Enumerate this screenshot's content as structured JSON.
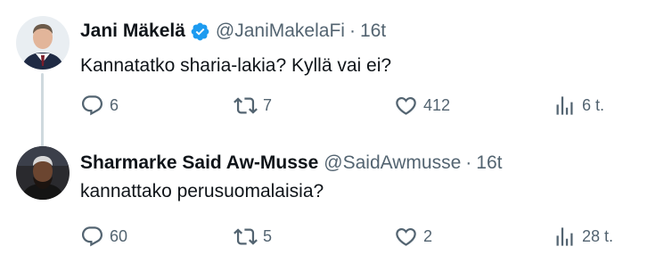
{
  "tweets": [
    {
      "name": "Jani Mäkelä",
      "verified": true,
      "handle": "@JaniMakelaFi",
      "separator": "·",
      "time": "16t",
      "text": "Kannatatko sharia-lakia? Kyllä vai ei?",
      "replies": "6",
      "retweets": "7",
      "likes": "412",
      "views": "6 t."
    },
    {
      "name": "Sharmarke Said Aw-Musse",
      "verified": false,
      "handle": "@SaidAwmusse",
      "separator": "·",
      "time": "16t",
      "text": "kannattako perusuomalaisia?",
      "replies": "60",
      "retweets": "5",
      "likes": "2",
      "views": "28 t."
    }
  ],
  "colors": {
    "text_primary": "#0f1419",
    "text_secondary": "#536471",
    "verified_blue": "#1d9bf0",
    "thread_line": "#cfd9de"
  },
  "icons": {
    "reply": "reply-icon",
    "retweet": "retweet-icon",
    "like": "like-icon",
    "views": "views-icon",
    "verified": "verified-badge-icon"
  }
}
